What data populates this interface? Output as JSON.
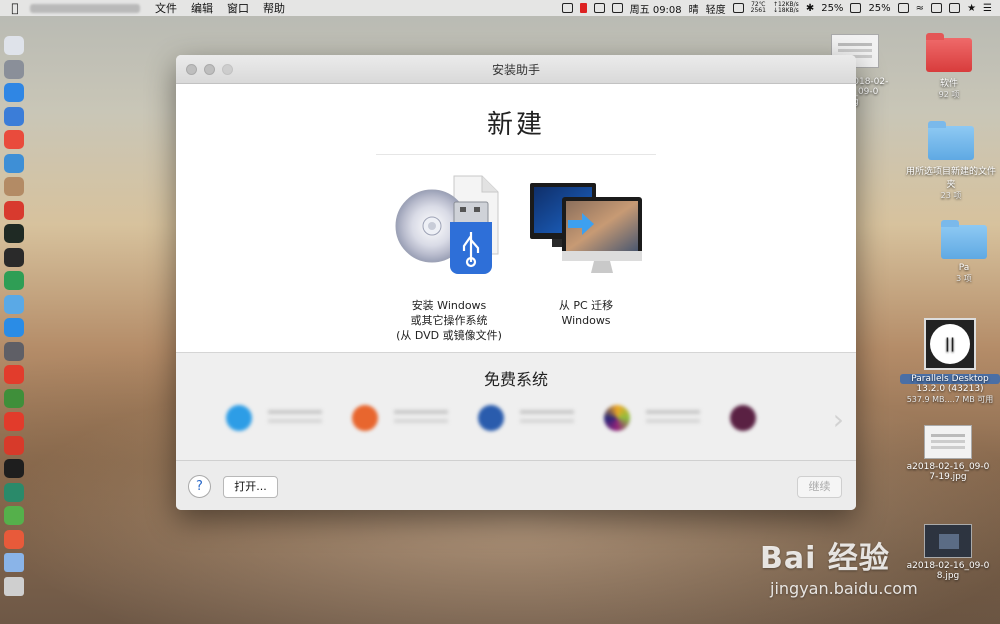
{
  "menubar": {
    "items": [
      "文件",
      "编辑",
      "窗口",
      "帮助"
    ],
    "time": "周五 09:08",
    "weather": "晴",
    "aqi": "轻度",
    "cpu_temp": "72℃",
    "cpu_other": "2561",
    "net_up": "↑12KB/s",
    "net_down": "↓18KB/s",
    "battery1": "25%",
    "battery2": "25%"
  },
  "window": {
    "title": "安装助手",
    "heading": "新建",
    "option_install": {
      "line1": "安装 Windows",
      "line2": "或其它操作系统",
      "line3": "(从 DVD 或镜像文件)"
    },
    "option_migrate": {
      "line1": "从 PC 迁移",
      "line2": "Windows"
    },
    "free_title": "免费系统",
    "open_button": "打开...",
    "continue_button": "继续",
    "help": "?"
  },
  "desktop": {
    "top_file": "a2018-02-16_09-0",
    "top_file_ext": ".jpg",
    "folder1": {
      "name": "软件",
      "count": "92 项"
    },
    "folder2": {
      "name": "用所选项目新建的文件夹",
      "count": "23 项"
    },
    "folder3": {
      "name": "Pa",
      "count": "3 项"
    },
    "parallels": {
      "name": "Parallels Desktop",
      "version": "13.2.0 (43213)",
      "size": "537.9 MB....7 MB 可用"
    },
    "file2": {
      "name": "a2018-02-16_09-0",
      "ext": "7-19.jpg"
    },
    "file3": {
      "name": "a2018-02-16_09-0",
      "ext": "8.jpg"
    }
  },
  "watermark": {
    "brand": "Bai 经验",
    "url": "jingyan.baidu.com"
  },
  "colors": {
    "dock": [
      "#dfe3ea",
      "#8a8f99",
      "#2f86e4",
      "#3b7dd8",
      "#e94b3c",
      "#3e8fd6",
      "#b38b65",
      "#d83a2e",
      "#1f2a24",
      "#2a2a2a",
      "#2f9e55",
      "#5aa9e6",
      "#2a8ce6",
      "#5f5f66",
      "#e23c2c",
      "#3f8f3a",
      "#e23b2b",
      "#d73a2a",
      "#1e1e1e",
      "#2a8a6a",
      "#55b04b",
      "#e85a3a",
      "#8ab4e8",
      "#cfcfcf"
    ]
  }
}
